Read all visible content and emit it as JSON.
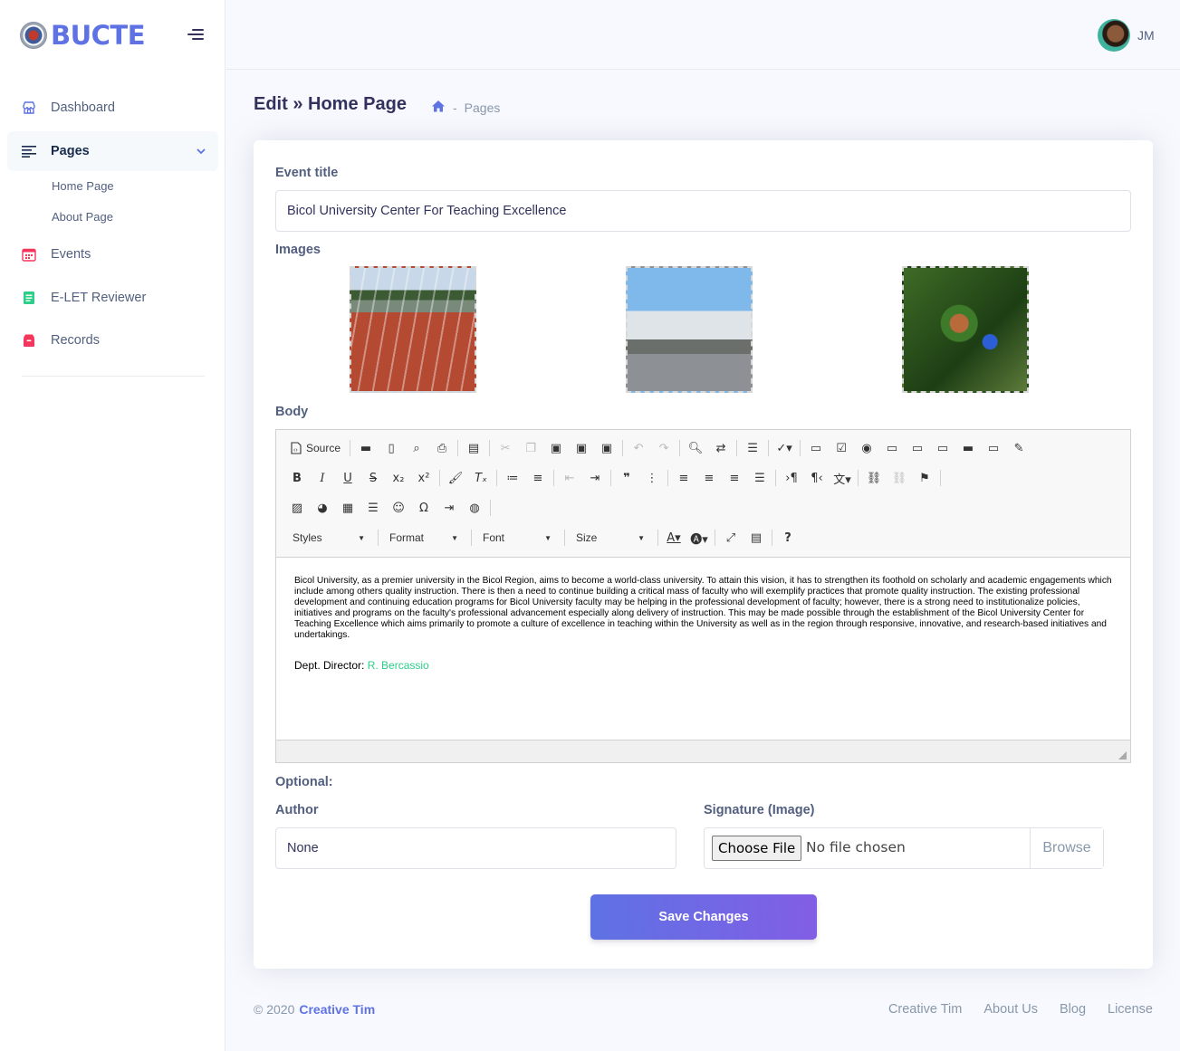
{
  "brand": {
    "name": "BUCTE"
  },
  "sidebar": {
    "items": [
      {
        "label": "Dashboard",
        "icon": "storefront-icon",
        "color": "#5e72e4"
      },
      {
        "label": "Pages",
        "icon": "align-left-icon",
        "color": "#172b4d"
      },
      {
        "label": "Events",
        "icon": "calendar-icon",
        "color": "#f5365c"
      },
      {
        "label": "E-LET Reviewer",
        "icon": "document-icon",
        "color": "#2dce89"
      },
      {
        "label": "Records",
        "icon": "archive-icon",
        "color": "#f5365c"
      }
    ],
    "subitems": [
      "Home Page",
      "About Page"
    ]
  },
  "topbar": {
    "user_initials": "JM"
  },
  "header": {
    "title": "Edit » Home Page",
    "breadcrumb_sep": "-",
    "breadcrumb_page": "Pages"
  },
  "form": {
    "event_title_label": "Event title",
    "event_title_value": "Bicol University Center For Teaching Excellence",
    "images_label": "Images",
    "body_label": "Body",
    "optional_label": "Optional:",
    "author_label": "Author",
    "author_value": "None",
    "signature_label": "Signature (Image)",
    "choose_file": "Choose File",
    "no_file": "No file chosen",
    "browse": "Browse",
    "save": "Save Changes"
  },
  "editor": {
    "source_label": "Source",
    "combos": [
      "Styles",
      "Format",
      "Font",
      "Size"
    ],
    "body_text": "Bicol University, as a premier university in the Bicol Region, aims to become a world-class university. To attain this vision, it has to strengthen its foothold on scholarly and academic engagements which include among others quality instruction. There is then a need to continue building a critical mass of faculty who will exemplify practices that promote quality instruction. The existing professional development and continuing education programs for Bicol University faculty may be helping in the professional development of faculty; however, there is a strong need to institutionalize policies, initiatives and programs on the faculty's professional advancement especially along delivery of instruction. This may be made possible through the establishment of the Bicol University Center for Teaching Excellence which aims primarily to promote a culture of excellence in teaching within the University as well as in the region through responsive, innovative, and research-based initiatives and undertakings.",
    "director_prefix": "Dept. Director: ",
    "director_name": "R. Bercassio"
  },
  "footer": {
    "copyright": "© 2020",
    "company": "Creative Tim",
    "links": [
      "Creative Tim",
      "About Us",
      "Blog",
      "License"
    ]
  },
  "colors": {
    "primary": "#5e72e4",
    "gradient_end": "#825ee4",
    "success": "#2dce89",
    "danger": "#f5365c"
  }
}
